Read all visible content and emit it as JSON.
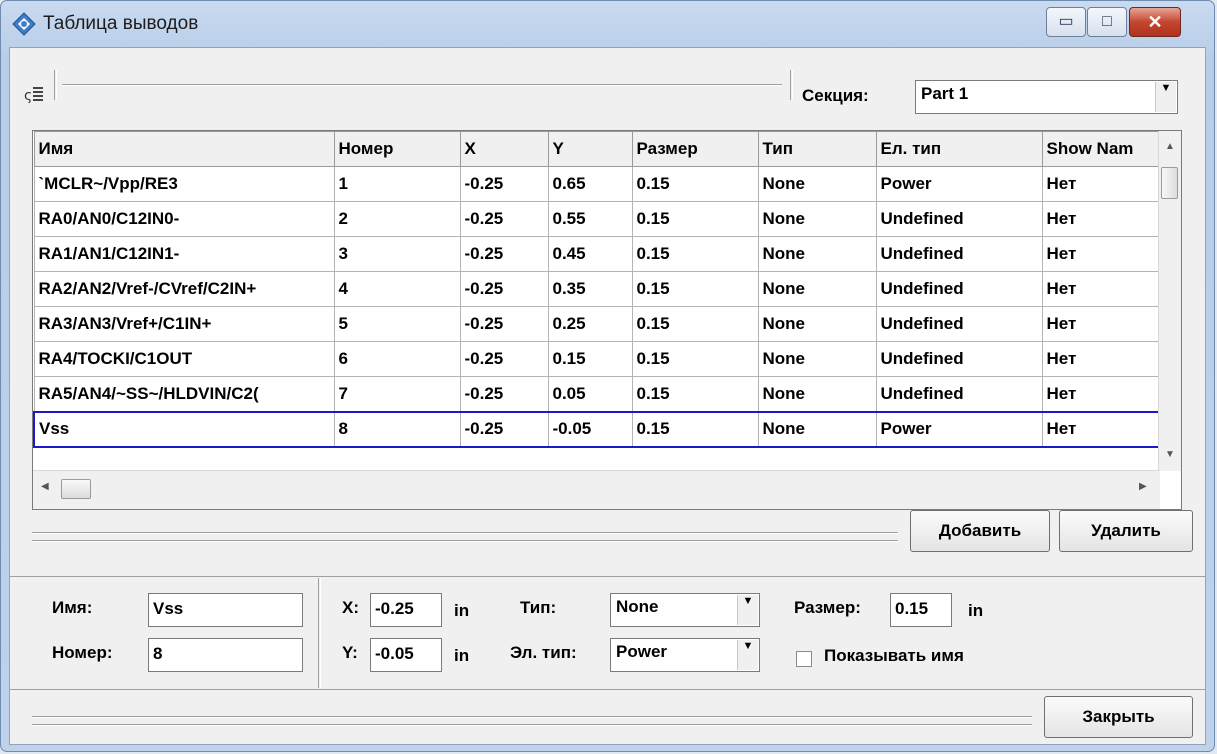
{
  "window": {
    "title": "Таблица выводов",
    "min_glyph": "▭",
    "max_glyph": "□",
    "close_glyph": "✕"
  },
  "toolbar": {
    "icon": "list-sort-icon",
    "section_label": "Секция:",
    "section_value": "Part 1"
  },
  "table": {
    "columns": [
      "Имя",
      "Номер",
      "X",
      "Y",
      "Размер",
      "Тип",
      "Ел. тип",
      "Show Nam"
    ],
    "rows": [
      [
        "`MCLR~/Vpp/RE3",
        "1",
        "-0.25",
        "0.65",
        "0.15",
        "None",
        "Power",
        "Нет"
      ],
      [
        "RA0/AN0/C12IN0-",
        "2",
        "-0.25",
        "0.55",
        "0.15",
        "None",
        "Undefined",
        "Нет"
      ],
      [
        "RA1/AN1/C12IN1-",
        "3",
        "-0.25",
        "0.45",
        "0.15",
        "None",
        "Undefined",
        "Нет"
      ],
      [
        "RA2/AN2/Vref-/CVref/C2IN+",
        "4",
        "-0.25",
        "0.35",
        "0.15",
        "None",
        "Undefined",
        "Нет"
      ],
      [
        "RA3/AN3/Vref+/C1IN+",
        "5",
        "-0.25",
        "0.25",
        "0.15",
        "None",
        "Undefined",
        "Нет"
      ],
      [
        "RA4/TOCKI/C1OUT",
        "6",
        "-0.25",
        "0.15",
        "0.15",
        "None",
        "Undefined",
        "Нет"
      ],
      [
        "RA5/AN4/~SS~/HLDVIN/C2(",
        "7",
        "-0.25",
        "0.05",
        "0.15",
        "None",
        "Undefined",
        "Нет"
      ],
      [
        "Vss",
        "8",
        "-0.25",
        "-0.05",
        "0.15",
        "None",
        "Power",
        "Нет"
      ]
    ],
    "selected_row": 7
  },
  "buttons": {
    "add": "Добавить",
    "delete": "Удалить",
    "close": "Закрыть"
  },
  "editor": {
    "name_label": "Имя:",
    "name_value": "Vss",
    "number_label": "Номер:",
    "number_value": "8",
    "x_label": "X:",
    "x_value": "-0.25",
    "x_unit": "in",
    "y_label": "Y:",
    "y_value": "-0.05",
    "y_unit": "in",
    "type_label": "Тип:",
    "type_value": "None",
    "eltype_label": "Эл. тип:",
    "eltype_value": "Power",
    "size_label": "Размер:",
    "size_value": "0.15",
    "size_unit": "in",
    "show_name_label": "Показывать имя",
    "show_name_checked": false
  },
  "colors": {
    "selection_border": "#1a1acc",
    "close_button": "#c4462f"
  }
}
